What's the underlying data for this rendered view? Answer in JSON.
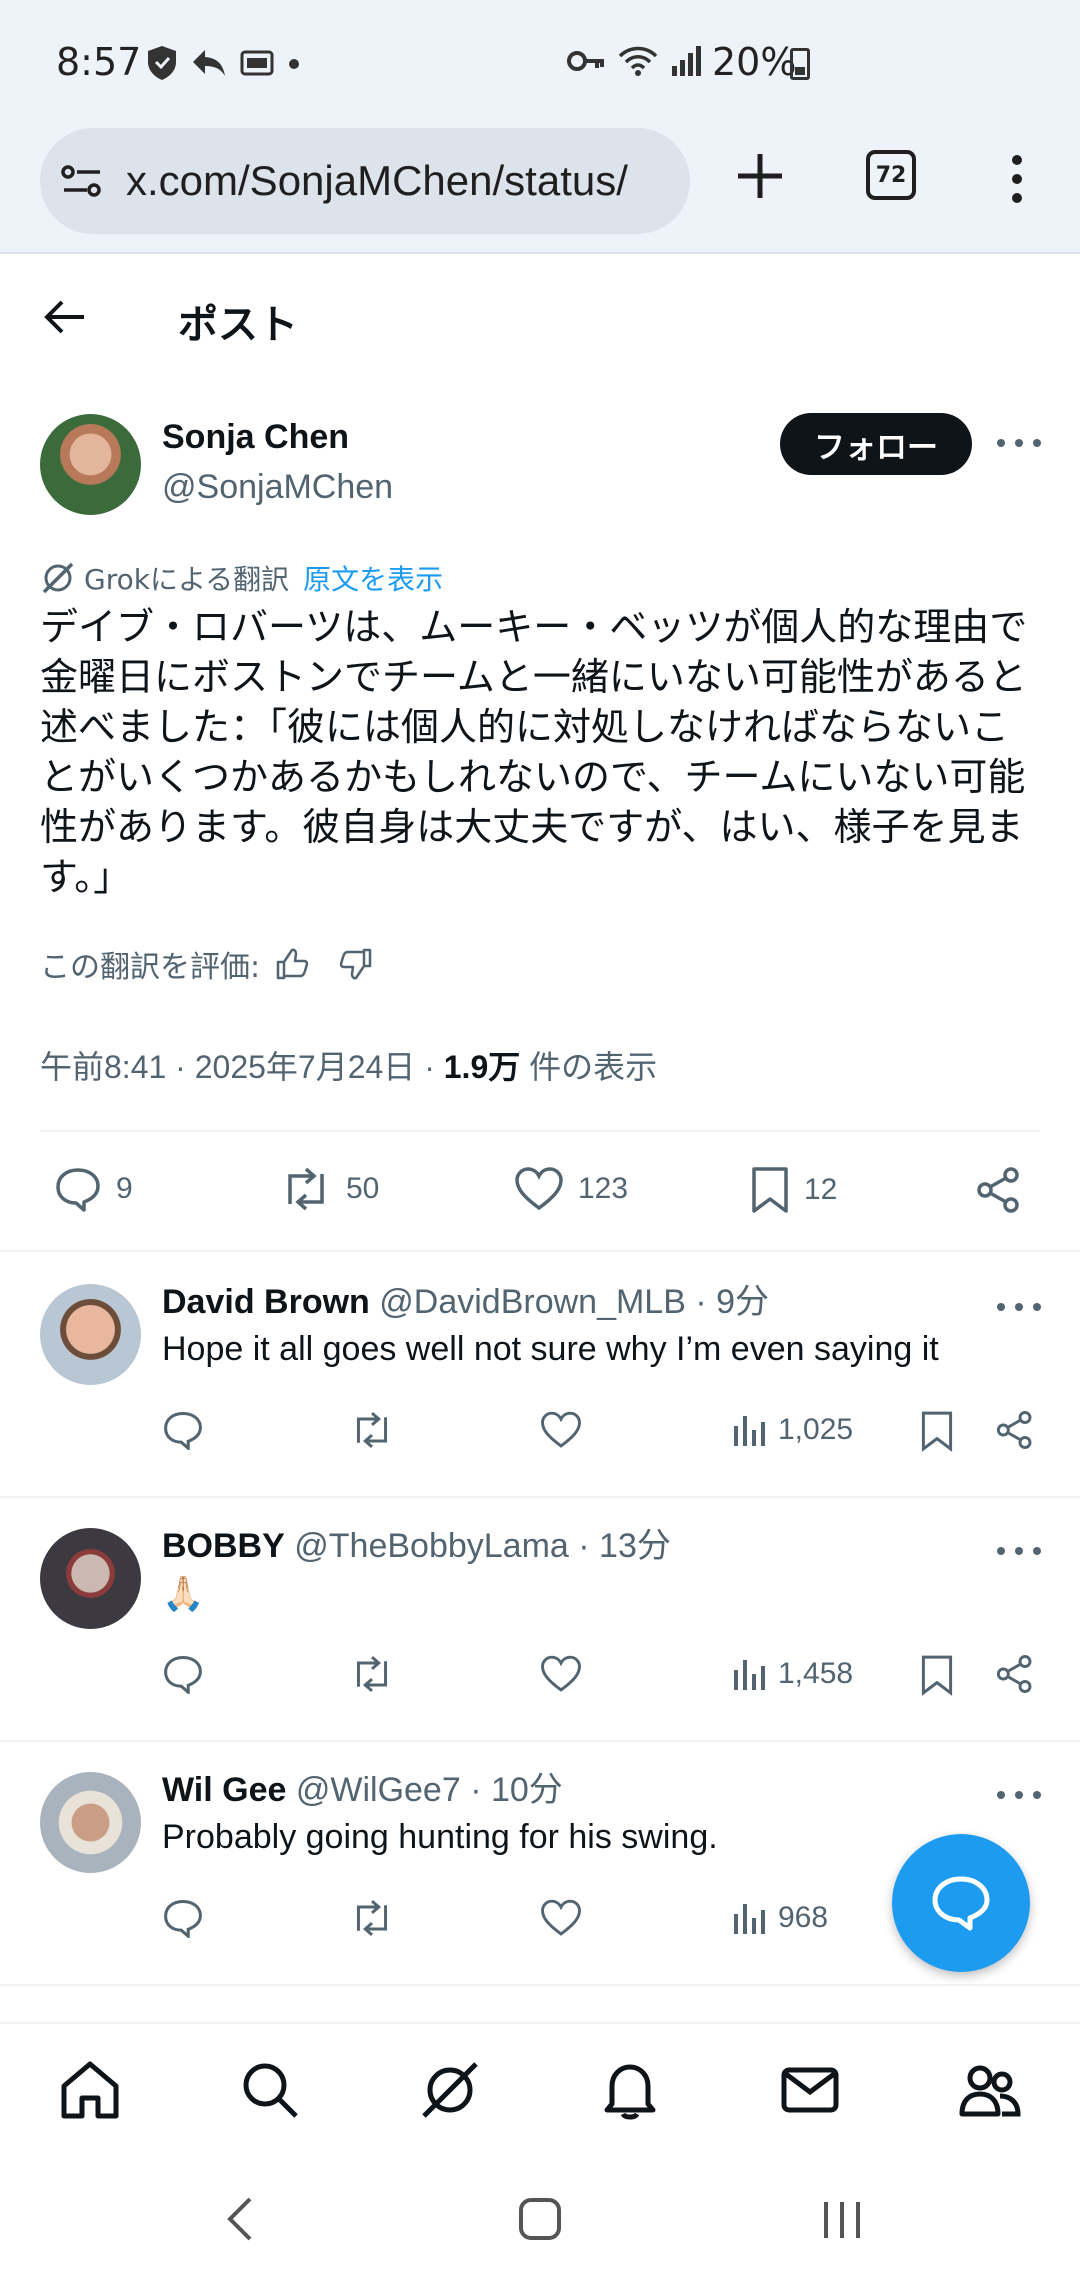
{
  "status_bar": {
    "time": "8:57",
    "battery": "20%",
    "icons": [
      "shield-icon",
      "reply-icon",
      "cast-icon",
      "dot-icon",
      "key-icon",
      "wifi-icon",
      "signal-icon",
      "battery-icon"
    ]
  },
  "browser": {
    "url": "x.com/SonjaMChen/status/",
    "tab_count": "72"
  },
  "header": {
    "title": "ポスト"
  },
  "post": {
    "author_name": "Sonja Chen",
    "author_handle": "@SonjaMChen",
    "follow_label": "フォロー",
    "translate_label": "Grokによる翻訳",
    "show_original": "原文を表示",
    "text": "デイブ・ロバーツは、ムーキー・ベッツが個人的な理由で金曜日にボストンでチームと一緒にいない可能性があると述べました：「彼には個人的に対処しなければならないことがいくつかあるかもしれないので、チームにいない可能性があります。彼自身は大丈夫ですが、はい、様子を見ます。」",
    "rate_label": "この翻訳を評価:",
    "timestamp": "午前8:41 · 2025年7月24日 · ",
    "views_count": "1.9万",
    "views_label": " 件の表示",
    "replies": "9",
    "reposts": "50",
    "likes": "123",
    "bookmarks": "12"
  },
  "replies": [
    {
      "name": "David Brown",
      "handle": "@DavidBrown_MLB",
      "time": "9分",
      "text": "Hope it all goes well not sure why I’m even saying it",
      "views": "1,025"
    },
    {
      "name": "BOBBY",
      "handle": "@TheBobbyLama",
      "time": "13分",
      "text": "🙏🏻",
      "views": "1,458"
    },
    {
      "name": "Wil Gee",
      "handle": "@WilGee7",
      "time": "10分",
      "text": "Probably going hunting for his swing.",
      "views": "968"
    }
  ],
  "bottom_nav": [
    "home-icon",
    "search-icon",
    "grok-icon",
    "notifications-icon",
    "messages-icon",
    "communities-icon"
  ],
  "colors": {
    "accent": "#1d9bf0",
    "text": "#0f1419",
    "muted": "#536471"
  }
}
